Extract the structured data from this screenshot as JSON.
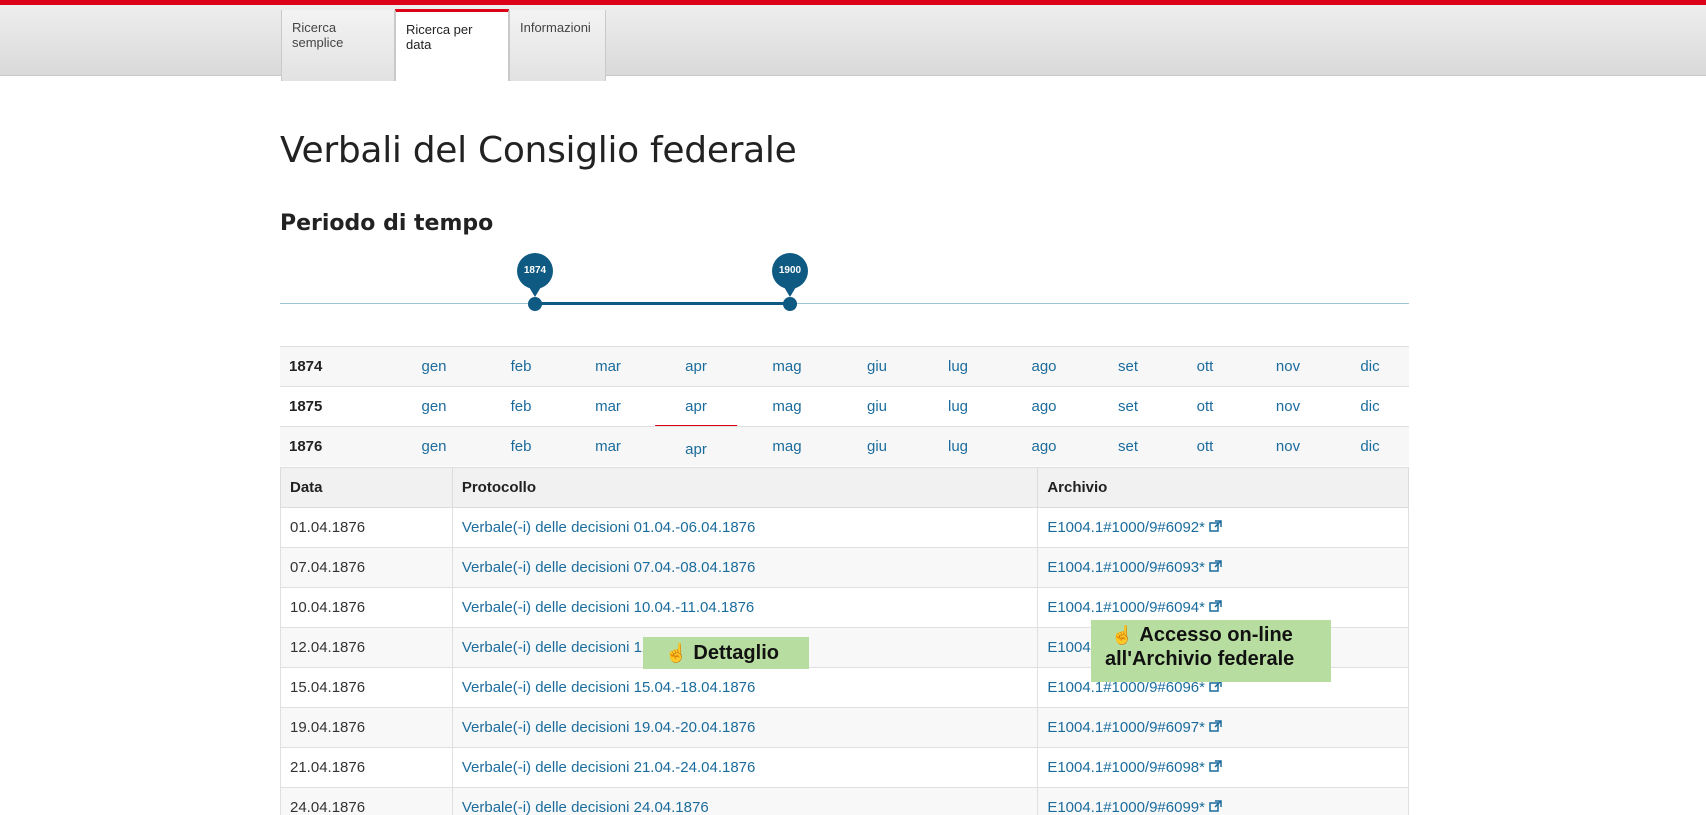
{
  "tabs": [
    {
      "label": "Ricerca semplice",
      "line1": "Ricerca",
      "line2": "semplice",
      "active": false
    },
    {
      "label": "Ricerca per data",
      "line1": "Ricerca per",
      "line2": "data",
      "active": true
    },
    {
      "label": "Informazioni",
      "line1": "Informazioni",
      "line2": "",
      "active": false
    }
  ],
  "page_title": "Verbali del Consiglio federale",
  "section_title": "Periodo di tempo",
  "slider": {
    "from": "1874",
    "to": "1900"
  },
  "years": [
    {
      "year": "1874"
    },
    {
      "year": "1875"
    },
    {
      "year": "1876"
    }
  ],
  "months": [
    "gen",
    "feb",
    "mar",
    "apr",
    "mag",
    "giu",
    "lug",
    "ago",
    "set",
    "ott",
    "nov",
    "dic"
  ],
  "selected": {
    "year": "1876",
    "month": "apr"
  },
  "table": {
    "headers": {
      "date": "Data",
      "protocol": "Protocollo",
      "archive": "Archivio"
    },
    "rows": [
      {
        "date": "01.04.1876",
        "protocol": "Verbale(-i) delle decisioni 01.04.-06.04.1876",
        "archive": "E1004.1#1000/9#6092*"
      },
      {
        "date": "07.04.1876",
        "protocol": "Verbale(-i) delle decisioni 07.04.-08.04.1876",
        "archive": "E1004.1#1000/9#6093*"
      },
      {
        "date": "10.04.1876",
        "protocol": "Verbale(-i) delle decisioni 10.04.-11.04.1876",
        "archive": "E1004.1#1000/9#6094*"
      },
      {
        "date": "12.04.1876",
        "protocol": "Verbale(-i) delle decisioni 12.04.-14.04.1876",
        "archive": "E1004.1#1000/9#6095*"
      },
      {
        "date": "15.04.1876",
        "protocol": "Verbale(-i) delle decisioni 15.04.-18.04.1876",
        "archive": "E1004.1#1000/9#6096*"
      },
      {
        "date": "19.04.1876",
        "protocol": "Verbale(-i) delle decisioni 19.04.-20.04.1876",
        "archive": "E1004.1#1000/9#6097*"
      },
      {
        "date": "21.04.1876",
        "protocol": "Verbale(-i) delle decisioni 21.04.-24.04.1876",
        "archive": "E1004.1#1000/9#6098*"
      },
      {
        "date": "24.04.1876",
        "protocol": "Verbale(-i) delle decisioni 24.04.1876",
        "archive": "E1004.1#1000/9#6099*"
      }
    ]
  },
  "callouts": {
    "detail": "Dettaglio",
    "archive_line1": "Accesso on-line",
    "archive_line2": "all'Archivio federale"
  },
  "colors": {
    "accent": "#dc0018",
    "link": "#1b6c9c",
    "slider": "#0f5a82",
    "callout": "#b7dea0"
  },
  "icons": {
    "external_link": "external-link-icon",
    "pointer": "hand-pointer-icon"
  }
}
